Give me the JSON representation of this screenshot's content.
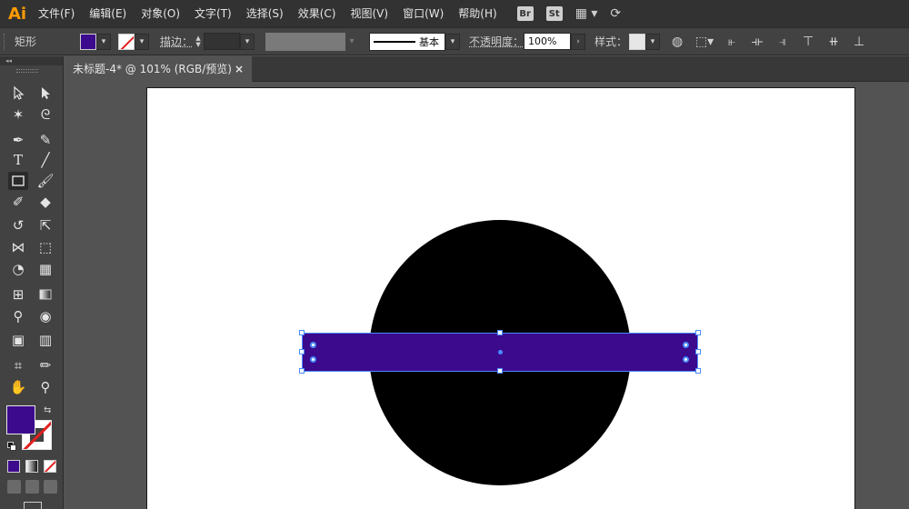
{
  "app": {
    "logo_text": "Ai"
  },
  "menu": {
    "items": [
      {
        "label": "文件(F)"
      },
      {
        "label": "编辑(E)"
      },
      {
        "label": "对象(O)"
      },
      {
        "label": "文字(T)"
      },
      {
        "label": "选择(S)"
      },
      {
        "label": "效果(C)"
      },
      {
        "label": "视图(V)"
      },
      {
        "label": "窗口(W)"
      },
      {
        "label": "帮助(H)"
      }
    ],
    "bridge_label": "Br",
    "stock_label": "St",
    "workspace_icon": "layout-grid-icon",
    "sync_icon": "sync-icon"
  },
  "control": {
    "tool_name": "矩形",
    "fill_color": "#3c0a8d",
    "stroke_state": "none",
    "stroke_label": "描边：",
    "stroke_weight": "",
    "brush_label": "基本",
    "opacity_label": "不透明度：",
    "opacity_value": "100%",
    "style_label": "样式：",
    "recolor_icon": "globe-icon",
    "transform_icon": "transform-icon",
    "align_icons": [
      "align-left-icon",
      "align-hcenter-icon",
      "align-right-icon",
      "align-top-icon",
      "align-vcenter-icon",
      "align-bottom-icon"
    ]
  },
  "document": {
    "tab_title": "未标题-4* @ 101% (RGB/预览)",
    "close_symbol": "×"
  },
  "tools": {
    "collapse_symbol": "◂◂",
    "fill_color": "#3c0a8d",
    "stroke_state": "none"
  },
  "canvas": {
    "artboard_color": "#ffffff",
    "circle_color": "#000000",
    "rect_color": "#3c0a8d",
    "selection_color": "#4a8cff"
  }
}
